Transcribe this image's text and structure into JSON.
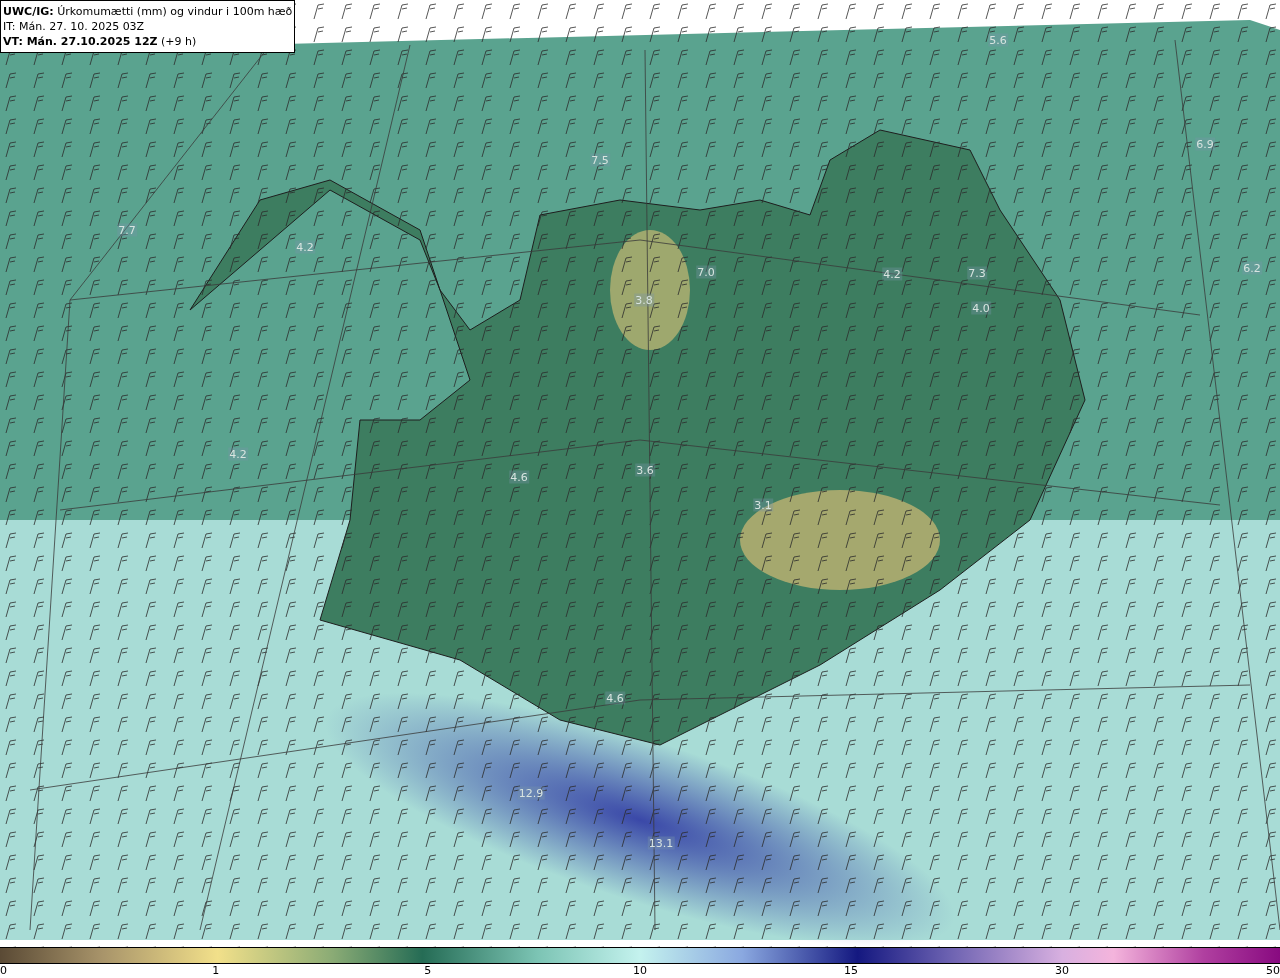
{
  "title_box": {
    "lines": [
      "**UWC/IG:** Úrkomumætti (mm) og vindur i 100m hæð",
      "IT: Mán. 27. 10. 2025 03Z",
      "**VT: Mán. 27.10.2025 12Z** (+9 h)"
    ]
  },
  "map_labels": [
    "5.6",
    "7.5",
    "6.9",
    "7.7",
    "4.2",
    "7.0",
    "3.8",
    "4.2",
    "7.3",
    "4.0",
    "6.2",
    "4.2",
    "4.6",
    "3.6",
    "3.1",
    "4.6",
    "12.9",
    "13.1"
  ],
  "colorbar": {
    "ticks": [
      "0",
      "1",
      "5",
      "10",
      "15",
      "30",
      "50"
    ]
  }
}
